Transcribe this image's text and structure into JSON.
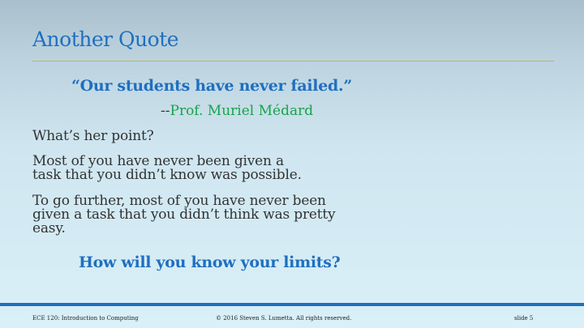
{
  "slide": {
    "title": "Another Quote",
    "quote": "“Our students have never failed.”",
    "attribution_dash": "--",
    "attribution_name": "Prof. Muriel Médard",
    "point_question": "What’s her point?",
    "para1": [
      "Most of you have never been given a",
      "task that you didn’t know was possible."
    ],
    "para2": [
      "To go further, most of you have never been",
      "given a task that you didn’t think was pretty",
      "easy."
    ],
    "closing_question": "How will you know your limits?"
  },
  "footer": {
    "course": "ECE 120: Introduction to Computing",
    "copyright": "© 2016 Steven S. Lumetta.  All rights reserved.",
    "slide_number": "slide 5"
  },
  "colors": {
    "accent_blue": "#1f6fc0",
    "attribution_green": "#16a34a",
    "rule_gold": "#c9b24a",
    "body_text": "#333333"
  }
}
